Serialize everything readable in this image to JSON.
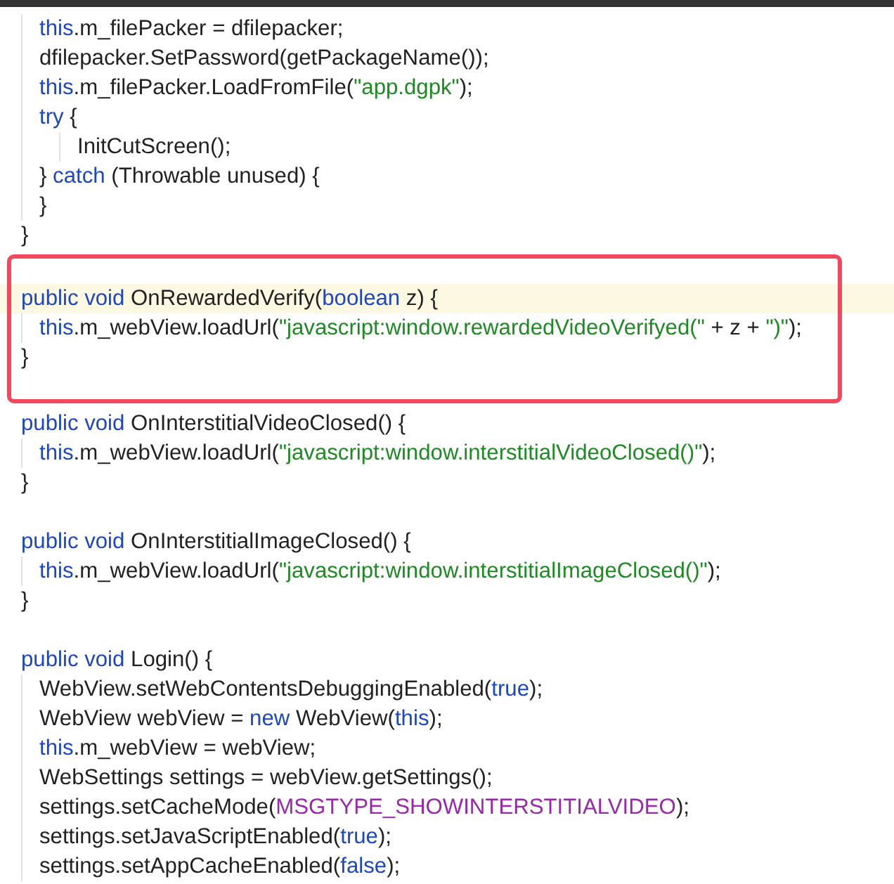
{
  "sections": [
    {
      "boxed": false,
      "lines": [
        {
          "kind": "code",
          "children": [
            {
              "kind": "code",
              "current": false,
              "tokens": [
                {
                  "kind": "kw",
                  "text": "this"
                },
                {
                  "kind": "plain",
                  "text": ".m_filePacker = dfilepacker;"
                }
              ]
            },
            {
              "kind": "code",
              "current": false,
              "tokens": [
                {
                  "kind": "plain",
                  "text": "dfilepacker.SetPassword(getPackageName());"
                }
              ]
            },
            {
              "kind": "code",
              "current": false,
              "tokens": [
                {
                  "kind": "kw",
                  "text": "this"
                },
                {
                  "kind": "plain",
                  "text": ".m_filePacker.LoadFromFile("
                },
                {
                  "kind": "str",
                  "text": "\"app.dgpk\""
                },
                {
                  "kind": "plain",
                  "text": ");"
                }
              ]
            },
            {
              "kind": "code",
              "current": false,
              "tokens": [
                {
                  "kind": "kw",
                  "text": "try"
                },
                {
                  "kind": "plain",
                  "text": " {"
                }
              ],
              "children": [
                {
                  "kind": "code",
                  "current": false,
                  "tokens": [
                    {
                      "kind": "plain",
                      "text": "InitCutScreen();"
                    }
                  ]
                }
              ]
            },
            {
              "kind": "code",
              "current": false,
              "tokens": [
                {
                  "kind": "plain",
                  "text": "} "
                },
                {
                  "kind": "kw",
                  "text": "catch"
                },
                {
                  "kind": "plain",
                  "text": " (Throwable unused) {"
                }
              ]
            },
            {
              "kind": "code",
              "current": false,
              "tokens": [
                {
                  "kind": "plain",
                  "text": "}"
                }
              ]
            }
          ]
        },
        {
          "kind": "code",
          "current": false,
          "tokens": [
            {
              "kind": "plain",
              "text": "}"
            }
          ]
        }
      ]
    },
    {
      "boxed": true,
      "lines": [
        {
          "kind": "code",
          "current": true,
          "tokens": [
            {
              "kind": "kw",
              "text": "public void"
            },
            {
              "kind": "plain",
              "text": " OnRewardedVerify("
            },
            {
              "kind": "kw",
              "text": "boolean"
            },
            {
              "kind": "plain",
              "text": " z) {"
            }
          ],
          "children": [
            {
              "kind": "code",
              "current": false,
              "tokens": [
                {
                  "kind": "kw",
                  "text": "this"
                },
                {
                  "kind": "plain",
                  "text": ".m_webView.loadUrl("
                },
                {
                  "kind": "str",
                  "text": "\"javascript:window.rewardedVideoVerifyed(\""
                },
                {
                  "kind": "plain",
                  "text": " + z + "
                },
                {
                  "kind": "str",
                  "text": "\")\""
                },
                {
                  "kind": "plain",
                  "text": ");"
                }
              ]
            }
          ]
        },
        {
          "kind": "code",
          "current": false,
          "tokens": [
            {
              "kind": "plain",
              "text": "}"
            }
          ]
        }
      ]
    },
    {
      "boxed": false,
      "lines": [
        {
          "kind": "code",
          "current": false,
          "tokens": [
            {
              "kind": "kw",
              "text": "public void"
            },
            {
              "kind": "plain",
              "text": " OnInterstitialVideoClosed() {"
            }
          ],
          "children": [
            {
              "kind": "code",
              "current": false,
              "tokens": [
                {
                  "kind": "kw",
                  "text": "this"
                },
                {
                  "kind": "plain",
                  "text": ".m_webView.loadUrl("
                },
                {
                  "kind": "str",
                  "text": "\"javascript:window.interstitialVideoClosed()\""
                },
                {
                  "kind": "plain",
                  "text": ");"
                }
              ]
            }
          ]
        },
        {
          "kind": "code",
          "current": false,
          "tokens": [
            {
              "kind": "plain",
              "text": "}"
            }
          ]
        },
        {
          "kind": "blank"
        },
        {
          "kind": "code",
          "current": false,
          "tokens": [
            {
              "kind": "kw",
              "text": "public void"
            },
            {
              "kind": "plain",
              "text": " OnInterstitialImageClosed() {"
            }
          ],
          "children": [
            {
              "kind": "code",
              "current": false,
              "tokens": [
                {
                  "kind": "kw",
                  "text": "this"
                },
                {
                  "kind": "plain",
                  "text": ".m_webView.loadUrl("
                },
                {
                  "kind": "str",
                  "text": "\"javascript:window.interstitialImageClosed()\""
                },
                {
                  "kind": "plain",
                  "text": ");"
                }
              ]
            }
          ]
        },
        {
          "kind": "code",
          "current": false,
          "tokens": [
            {
              "kind": "plain",
              "text": "}"
            }
          ]
        },
        {
          "kind": "blank"
        },
        {
          "kind": "code",
          "current": false,
          "tokens": [
            {
              "kind": "kw",
              "text": "public void"
            },
            {
              "kind": "plain",
              "text": " Login() {"
            }
          ],
          "children": [
            {
              "kind": "code",
              "current": false,
              "tokens": [
                {
                  "kind": "plain",
                  "text": "WebView.setWebContentsDebuggingEnabled("
                },
                {
                  "kind": "kw",
                  "text": "true"
                },
                {
                  "kind": "plain",
                  "text": ");"
                }
              ]
            },
            {
              "kind": "code",
              "current": false,
              "tokens": [
                {
                  "kind": "plain",
                  "text": "WebView webView = "
                },
                {
                  "kind": "kw",
                  "text": "new"
                },
                {
                  "kind": "plain",
                  "text": " WebView("
                },
                {
                  "kind": "kw",
                  "text": "this"
                },
                {
                  "kind": "plain",
                  "text": ");"
                }
              ]
            },
            {
              "kind": "code",
              "current": false,
              "tokens": [
                {
                  "kind": "kw",
                  "text": "this"
                },
                {
                  "kind": "plain",
                  "text": ".m_webView = webView;"
                }
              ]
            },
            {
              "kind": "code",
              "current": false,
              "tokens": [
                {
                  "kind": "plain",
                  "text": "WebSettings settings = webView.getSettings();"
                }
              ]
            },
            {
              "kind": "code",
              "current": false,
              "tokens": [
                {
                  "kind": "plain",
                  "text": "settings.setCacheMode("
                },
                {
                  "kind": "const",
                  "text": "MSGTYPE_SHOWINTERSTITIALVIDEO"
                },
                {
                  "kind": "plain",
                  "text": ");"
                }
              ]
            },
            {
              "kind": "code",
              "current": false,
              "tokens": [
                {
                  "kind": "plain",
                  "text": "settings.setJavaScriptEnabled("
                },
                {
                  "kind": "kw",
                  "text": "true"
                },
                {
                  "kind": "plain",
                  "text": ");"
                }
              ]
            },
            {
              "kind": "code",
              "current": false,
              "tokens": [
                {
                  "kind": "plain",
                  "text": "settings.setAppCacheEnabled("
                },
                {
                  "kind": "kw",
                  "text": "false"
                },
                {
                  "kind": "plain",
                  "text": ");"
                }
              ]
            }
          ]
        }
      ]
    }
  ]
}
